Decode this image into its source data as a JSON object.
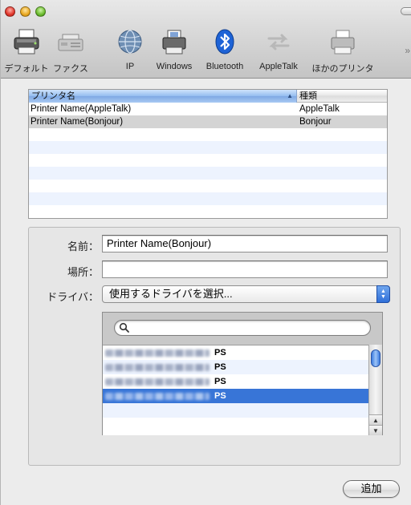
{
  "toolbar": {
    "items": [
      {
        "label": "デフォルト",
        "icon": "default-printer-icon"
      },
      {
        "label": "ファクス",
        "icon": "fax-icon"
      },
      {
        "label": "IP",
        "icon": "ip-globe-icon"
      },
      {
        "label": "Windows",
        "icon": "windows-printer-icon"
      },
      {
        "label": "Bluetooth",
        "icon": "bluetooth-icon"
      },
      {
        "label": "AppleTalk",
        "icon": "appletalk-icon"
      },
      {
        "label": "ほかのプリンタ",
        "icon": "other-printer-icon"
      }
    ],
    "more": "»"
  },
  "printer_list": {
    "columns": [
      "プリンタ名",
      "種類"
    ],
    "sort_indicator": "▲",
    "rows": [
      {
        "name": "Printer Name(AppleTalk)",
        "kind": "AppleTalk"
      },
      {
        "name": "Printer Name(Bonjour)",
        "kind": "Bonjour"
      }
    ],
    "selected_index": 1
  },
  "details": {
    "name_label": "名前：",
    "name_value": "Printer Name(Bonjour)",
    "location_label": "場所：",
    "location_value": "",
    "driver_label": "ドライバ：",
    "driver_selected": "使用するドライバを選択..."
  },
  "driver_picker": {
    "search_value": "",
    "rows": [
      {
        "suffix": "PS"
      },
      {
        "suffix": "PS"
      },
      {
        "suffix": "PS"
      },
      {
        "suffix": "PS"
      }
    ],
    "selected_index": 3
  },
  "add_button": {
    "label": "追加"
  },
  "colors": {
    "selection": "#3875d7",
    "header_blue": "#93bdf0",
    "window_bg": "#ececec"
  }
}
